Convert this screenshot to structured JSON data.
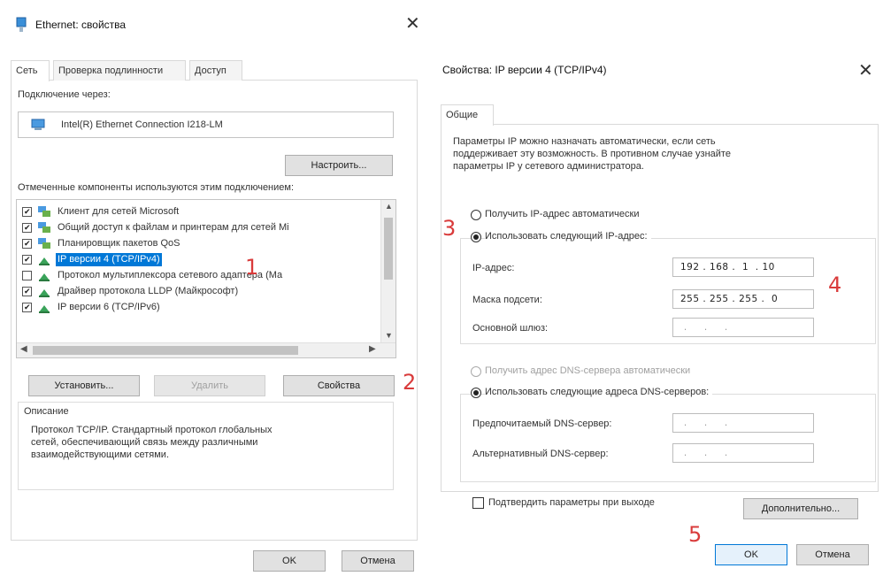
{
  "left": {
    "title": "Ethernet: свойства",
    "tabs": [
      "Сеть",
      "Проверка подлинности",
      "Доступ"
    ],
    "connect_via_label": "Подключение через:",
    "adapter_name": "Intel(R) Ethernet Connection I218-LM",
    "configure_button": "Настроить...",
    "components_label": "Отмеченные компоненты используются этим подключением:",
    "components": [
      {
        "label": "Клиент для сетей Microsoft",
        "checked": true,
        "selected": false
      },
      {
        "label": "Общий доступ к файлам и принтерам для сетей Mi",
        "checked": true,
        "selected": false
      },
      {
        "label": "Планировщик пакетов QoS",
        "checked": true,
        "selected": false
      },
      {
        "label": "IP версии 4 (TCP/IPv4)",
        "checked": true,
        "selected": true
      },
      {
        "label": "Протокол мультиплексора сетевого адаптера (Ма",
        "checked": false,
        "selected": false
      },
      {
        "label": "Драйвер протокола LLDP (Майкрософт)",
        "checked": true,
        "selected": false
      },
      {
        "label": "IP версии 6 (TCP/IPv6)",
        "checked": true,
        "selected": false
      }
    ],
    "install_button": "Установить...",
    "remove_button": "Удалить",
    "properties_button": "Свойства",
    "description_title": "Описание",
    "description_text": [
      "Протокол TCP/IP. Стандартный протокол глобальных",
      "сетей, обеспечивающий связь между различными",
      "взаимодействующими сетями."
    ],
    "ok_button": "OK",
    "cancel_button": "Отмена"
  },
  "right": {
    "title": "Свойства: IP версии 4 (TCP/IPv4)",
    "tab": "Общие",
    "intro_text": [
      "Параметры IP можно назначать автоматически, если сеть",
      "поддерживает эту возможность. В противном случае узнайте",
      "параметры IP у сетевого администратора."
    ],
    "auto_ip_label": "Получить IP-адрес автоматически",
    "manual_ip_label": "Использовать следующий IP-адрес:",
    "ip_label": "IP-адрес:",
    "ip_value": "192 . 168 .  1  . 10",
    "mask_label": "Маска подсети:",
    "mask_value": "255 . 255 . 255 .  0",
    "gateway_label": "Основной шлюз:",
    "gateway_value": " .     .     .",
    "auto_dns_label": "Получить адрес DNS-сервера автоматически",
    "manual_dns_label": "Использовать следующие адреса DNS-серверов:",
    "pref_dns_label": "Предпочитаемый DNS-сервер:",
    "pref_dns_value": " .     .     .",
    "alt_dns_label": "Альтернативный DNS-сервер:",
    "alt_dns_value": " .     .     .",
    "validate_label": "Подтвердить параметры при выходе",
    "advanced_button": "Дополнительно...",
    "ok_button": "OK",
    "cancel_button": "Отмена"
  },
  "annotations": [
    "1",
    "2",
    "3",
    "4",
    "5"
  ],
  "colors": {
    "selection": "#0078d7",
    "annotation": "#d93b3b"
  }
}
